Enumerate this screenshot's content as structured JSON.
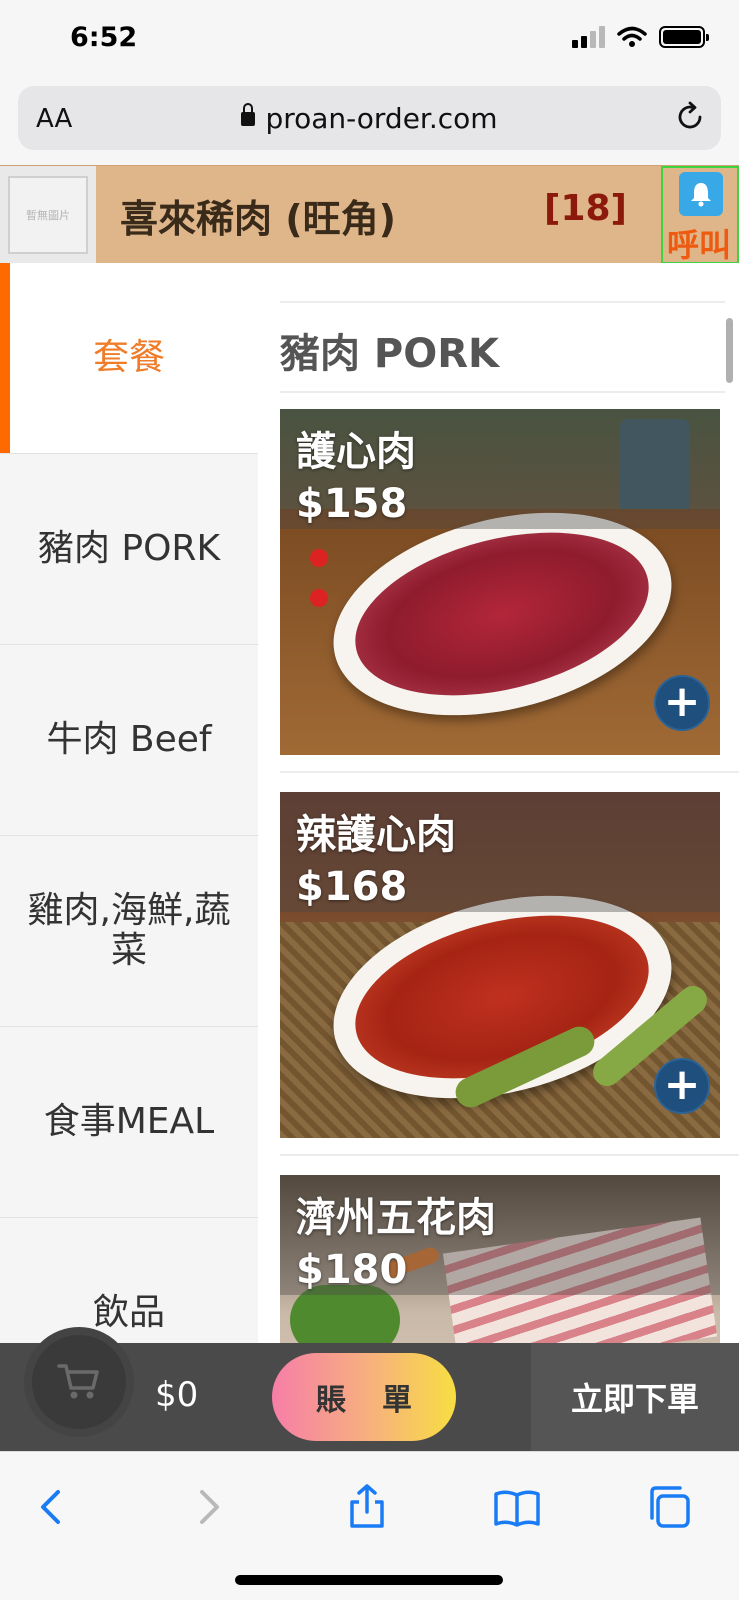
{
  "status_bar": {
    "time": "6:52"
  },
  "browser": {
    "text_size_label": "AA",
    "url": "proan-order.com"
  },
  "header": {
    "logo_placeholder": "暫無圖片",
    "shop_name": "喜來稀肉 (旺角)",
    "table_number": "[18]",
    "call_label": "呼叫"
  },
  "categories": [
    {
      "label": "套餐",
      "active": true
    },
    {
      "label": "豬肉 PORK",
      "active": false
    },
    {
      "label": "牛肉 Beef",
      "active": false
    },
    {
      "label": "雞肉,海鮮,蔬菜",
      "active": false
    },
    {
      "label": "食事MEAL",
      "active": false
    },
    {
      "label": "飲品",
      "active": false
    }
  ],
  "section": {
    "title": "豬肉 PORK"
  },
  "products": [
    {
      "name": "護心肉",
      "price": "$158"
    },
    {
      "name": "辣護心肉",
      "price": "$168"
    },
    {
      "name": "濟州五花肉",
      "price": "$180"
    }
  ],
  "order_bar": {
    "total": "$0",
    "bill_char_1": "賬",
    "bill_char_2": "單",
    "submit_label": "立即下單"
  },
  "colors": {
    "header_bg": "#dfb68a",
    "accent_orange": "#ff6a00",
    "add_button": "#1f4f7c",
    "call_border": "#3fd43f"
  }
}
